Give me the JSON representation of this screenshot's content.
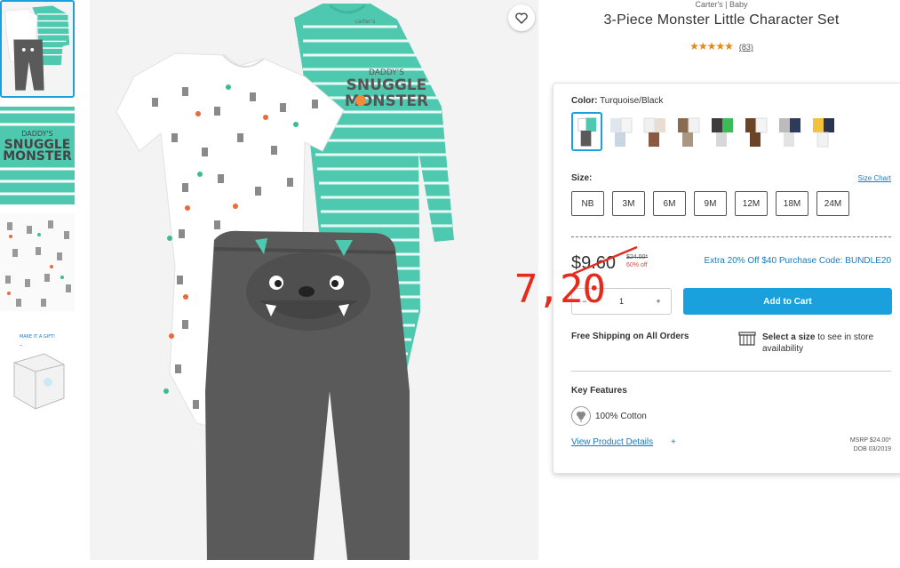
{
  "product": {
    "breadcrumb": "Carter's | Baby",
    "title": "3-Piece Monster Little Character Set",
    "stars": "★★★★★",
    "review_count": "(83)",
    "rating": 5
  },
  "main_image": {
    "bodysuit_text_line1": "DADDY'S",
    "bodysuit_text_line2": "SNUGGLE",
    "bodysuit_text_line3": "MONSTER",
    "tag_text": "carter's"
  },
  "thumbnails": {
    "thumb2_line1": "DADDY'S",
    "thumb2_line2": "SNUGGLE",
    "thumb2_line3": "MONSTER",
    "thumb4_text": "MAKE IT A GIFT!"
  },
  "color": {
    "label": "Color:",
    "value": "Turquoise/Black",
    "swatch_count": 9,
    "selected_index": 0
  },
  "size": {
    "label": "Size:",
    "chart_link": "Size Chart",
    "options": [
      "NB",
      "3M",
      "6M",
      "9M",
      "12M",
      "18M",
      "24M"
    ]
  },
  "pricing": {
    "sale_price": "$9.60",
    "original_price": "$24.00*",
    "percent_off": "60% off",
    "promo": "Extra 20% Off $40 Purchase Code: BUNDLE20",
    "overlay_price": "7,20"
  },
  "cart": {
    "qty_minus": "−",
    "quantity": "1",
    "qty_plus": "+",
    "add_to_cart": "Add to Cart"
  },
  "shipping": {
    "free_shipping": "Free Shipping on All Orders",
    "store_bold": "Select a size",
    "store_rest": " to see in store availability"
  },
  "features": {
    "title": "Key Features",
    "cotton": "100% Cotton",
    "details_link": "View Product Details",
    "details_plus": "+",
    "msrp": "MSRP $24.00*",
    "dob": "DOB 03/2019"
  },
  "colors": {
    "accent": "#1aa0dd",
    "link": "#1a7ac4",
    "turquoise": "#4ec9b0",
    "pants": "#5a5a5a",
    "overlay_red": "#e52b1e",
    "stars": "#e58a12"
  },
  "icons": {
    "favorite": "heart-icon",
    "store": "store-icon",
    "cotton": "cotton-icon"
  }
}
